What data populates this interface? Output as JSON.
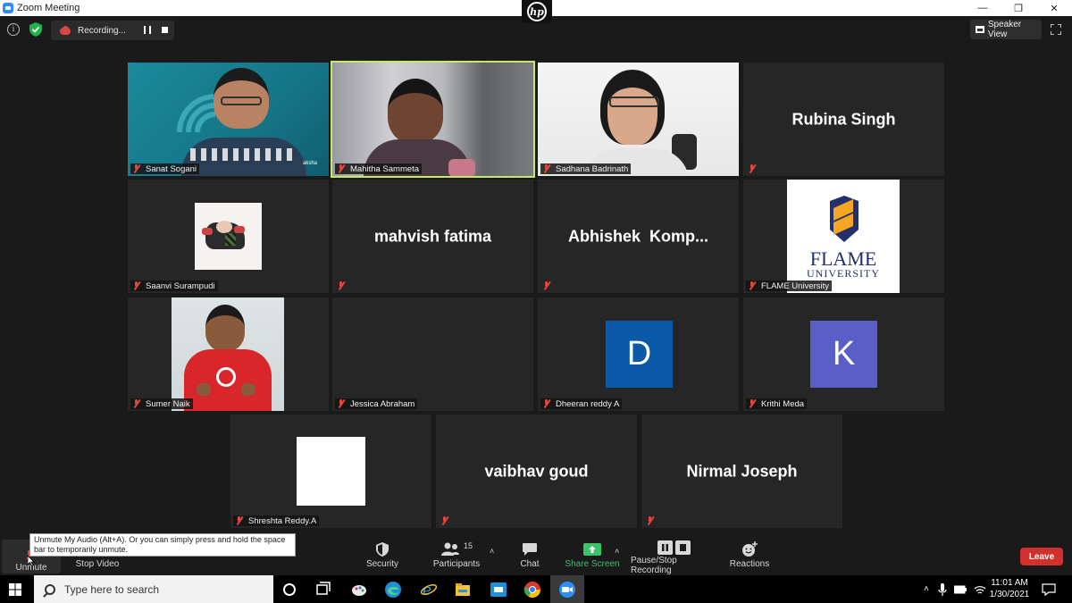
{
  "window": {
    "title": "Zoom Meeting",
    "controls": [
      "minimize",
      "restore",
      "close"
    ]
  },
  "topbar": {
    "recording_label": "Recording...",
    "view_label": "Speaker View"
  },
  "participants": [
    {
      "name": "Sanat Sogani",
      "type": "video",
      "muted": true
    },
    {
      "name": "Mahitha Sammeta",
      "type": "video",
      "muted": true,
      "active_speaker": true
    },
    {
      "name": "Sadhana Badrinath",
      "type": "video",
      "muted": true
    },
    {
      "name": "Rubina Singh",
      "type": "name",
      "display": "Rubina Singh",
      "muted": true
    },
    {
      "name": "Saanvi Surampudi",
      "type": "picture",
      "muted": true
    },
    {
      "name": "mahvish fatima",
      "type": "name",
      "display": "mahvish fatima",
      "muted": true
    },
    {
      "name": "Abhishek Komp...",
      "type": "name",
      "display": "Abhishek  Komp...",
      "muted": true
    },
    {
      "name": "FLAME University",
      "type": "logo",
      "logo_text_1": "FLAME",
      "logo_text_2": "UNIVERSITY",
      "muted": true
    },
    {
      "name": "Sumer Naik",
      "type": "picture",
      "muted": true
    },
    {
      "name": "Jessica Abraham",
      "type": "blank",
      "muted": true
    },
    {
      "name": "Dheeran reddy A",
      "type": "initial",
      "initial": "D",
      "color": "#0b5aa8",
      "muted": true
    },
    {
      "name": "Krithi Meda",
      "type": "initial",
      "initial": "K",
      "color": "#5a5fc7",
      "muted": true
    },
    {
      "name": "Shreshta Reddy.A",
      "type": "picture-white",
      "muted": true
    },
    {
      "name": "vaibhav goud",
      "type": "name",
      "display": "vaibhav goud",
      "muted": true
    },
    {
      "name": "Nirmal Joseph",
      "type": "name",
      "display": "Nirmal Joseph",
      "muted": true
    }
  ],
  "tooltip": {
    "text": "Unmute My Audio (Alt+A). Or you can simply press and hold the space bar to temporarily unmute."
  },
  "toolbar": {
    "unmute": "Unmute",
    "stop_video": "Stop Video",
    "security": "Security",
    "participants": "Participants",
    "participants_count": "15",
    "chat": "Chat",
    "share_screen": "Share Screen",
    "pause_stop_recording": "Pause/Stop Recording",
    "reactions": "Reactions",
    "leave": "Leave"
  },
  "taskbar": {
    "search_placeholder": "Type here to search",
    "time": "11:01 AM",
    "date": "1/30/2021"
  },
  "colors": {
    "active_speaker_border": "#c8e66a",
    "leave_red": "#d0312d",
    "share_green": "#39c46a",
    "mute_red": "#e5463c"
  }
}
